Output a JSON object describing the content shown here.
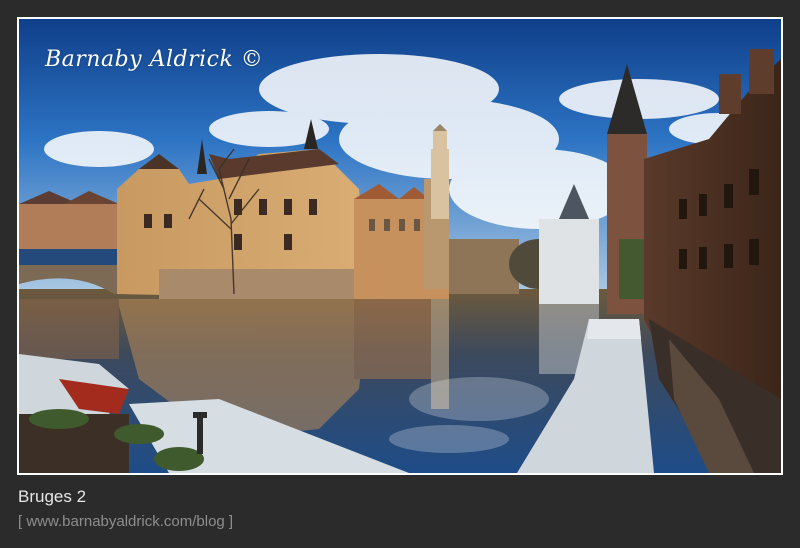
{
  "photo": {
    "signature": "Barnaby Aldrick ©"
  },
  "caption": {
    "title": "Bruges 2",
    "url": "[ www.barnabyaldrick.com/blog ]"
  },
  "colors": {
    "background": "#2b2b2b",
    "frame": "#ffffff",
    "sky": "#1d5fb0",
    "caption_title": "#e6e6e6",
    "caption_url": "#8e8e8e"
  }
}
